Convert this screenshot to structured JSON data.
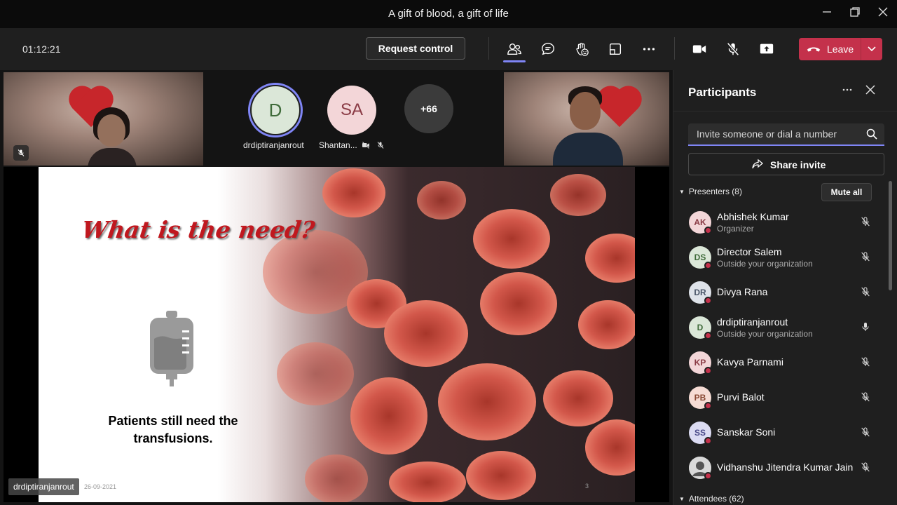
{
  "window": {
    "title": "A gift of blood, a gift of life"
  },
  "toolbar": {
    "timer": "01:12:21",
    "request_control_label": "Request control",
    "leave_label": "Leave",
    "accent_color": "#7f85f5",
    "leave_color": "#c4314b"
  },
  "stage": {
    "avatars": [
      {
        "initials": "D",
        "name": "drdiptiranjanrout"
      },
      {
        "initials": "SA",
        "name": "Shantan..."
      },
      {
        "initials": "+66"
      }
    ],
    "slide": {
      "title": "What is the need?",
      "text_line1": "Patients still need the",
      "text_line2": "transfusions.",
      "page_number": "3"
    },
    "presenter_tag": "drdiptiranjanrout",
    "date": "26-09-2021"
  },
  "panel": {
    "title": "Participants",
    "invite_placeholder": "Invite someone or dial a number",
    "share_invite_label": "Share invite",
    "presenters_label": "Presenters (8)",
    "mute_all_label": "Mute all",
    "attendees_label": "Attendees (62)",
    "participants": [
      {
        "initials": "AK",
        "name": "Abhishek Kumar",
        "sub": "Organizer",
        "mic": "muted",
        "avatar_bg": "#f3d6d8",
        "avatar_fg": "#8a3b45"
      },
      {
        "initials": "DS",
        "name": "Director Salem",
        "sub": "Outside your organization",
        "mic": "muted",
        "avatar_bg": "#dbe7d8",
        "avatar_fg": "#3f6b3a"
      },
      {
        "initials": "DR",
        "name": "Divya Rana",
        "sub": "",
        "mic": "muted",
        "avatar_bg": "#dfe3ea",
        "avatar_fg": "#4a5568"
      },
      {
        "initials": "D",
        "name": "drdiptiranjanrout",
        "sub": "Outside your organization",
        "mic": "on",
        "avatar_bg": "#dbe7d8",
        "avatar_fg": "#3f6b3a"
      },
      {
        "initials": "KP",
        "name": "Kavya Parnami",
        "sub": "",
        "mic": "muted",
        "avatar_bg": "#f3d6d8",
        "avatar_fg": "#8a3b45"
      },
      {
        "initials": "PB",
        "name": "Purvi Balot",
        "sub": "",
        "mic": "muted",
        "avatar_bg": "#f6dcd4",
        "avatar_fg": "#8a4a35"
      },
      {
        "initials": "SS",
        "name": "Sanskar Soni",
        "sub": "",
        "mic": "muted",
        "avatar_bg": "#dcdcf3",
        "avatar_fg": "#4b4b8a"
      },
      {
        "initials": "",
        "name": "Vidhanshu Jitendra Kumar Jain",
        "sub": "",
        "mic": "muted",
        "avatar_bg": "#c9c9c9",
        "avatar_fg": "#333333"
      }
    ]
  }
}
